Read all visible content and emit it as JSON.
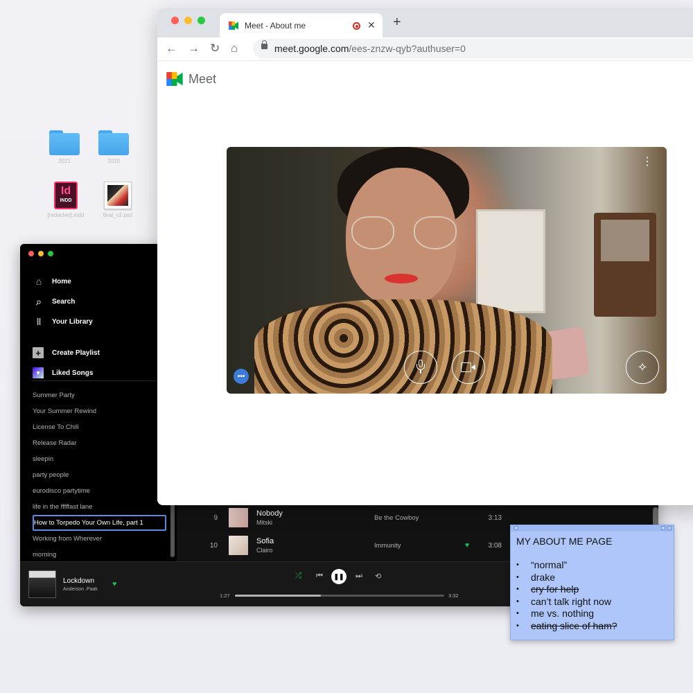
{
  "desktop": {
    "icons": [
      {
        "type": "folder",
        "label": "2021"
      },
      {
        "type": "folder",
        "label": "2020"
      },
      {
        "type": "indd",
        "label": "[redacted].indd",
        "glyph": "Id",
        "badge": "INDD"
      },
      {
        "type": "psd",
        "label": "final_v2.psd"
      }
    ]
  },
  "spotify": {
    "nav": [
      {
        "label": "Home",
        "icon": "home-icon"
      },
      {
        "label": "Search",
        "icon": "search-icon"
      },
      {
        "label": "Your Library",
        "icon": "library-icon"
      }
    ],
    "create_playlist": "Create Playlist",
    "liked_songs": "Liked Songs",
    "playlists": [
      "Summer Party",
      "Your Summer Rewind",
      "License To Chill",
      "Release Radar",
      "sleepin",
      "party people",
      "eurodisco partytime",
      "life in the fffffast lane",
      "How to Torpedo Your Own Life, part 1",
      "Working from Wherever",
      "morning"
    ],
    "selected_playlist_index": 8,
    "tracks": [
      {
        "num": "9",
        "title": "Nobody",
        "artist": "Mitski",
        "album": "Be the Cowboy",
        "liked": false,
        "duration": "3:13"
      },
      {
        "num": "10",
        "title": "Sofia",
        "artist": "Clairo",
        "album": "Immunity",
        "liked": true,
        "duration": "3:08"
      }
    ],
    "now_playing": {
      "title": "Lockdown",
      "artist": "Anderson .Paak",
      "elapsed": "1:27",
      "total": "3:32",
      "progress": 0.41
    },
    "accent": "#1db954"
  },
  "browser": {
    "tab_title": "Meet - About me",
    "new_tab_symbol": "+",
    "url_host": "meet.google.com",
    "url_path": "/ees-znzw-qyb?authuser=0",
    "app_name": "Meet"
  },
  "note": {
    "title": "MY ABOUT ME PAGE",
    "items": [
      {
        "text": "“normal”",
        "struck": false
      },
      {
        "text": "drake",
        "struck": false
      },
      {
        "text": "cry for help",
        "struck": true
      },
      {
        "text": "can’t talk right now",
        "struck": false
      },
      {
        "text": "me vs. nothing",
        "struck": false
      },
      {
        "text": "eating slice of ham?",
        "struck": true
      }
    ],
    "color": "#aec6fa"
  }
}
